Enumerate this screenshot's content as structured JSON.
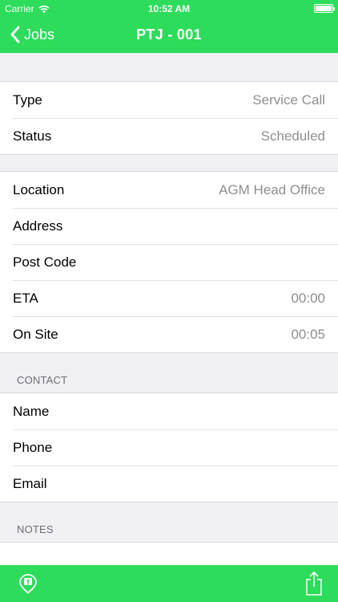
{
  "status_bar": {
    "carrier": "Carrier",
    "time": "10:52 AM",
    "wifi_icon": "wifi-icon",
    "battery_icon": "battery-icon"
  },
  "nav": {
    "back_label": "Jobs",
    "title": "PTJ - 001"
  },
  "job": {
    "type_label": "Type",
    "type_value": "Service Call",
    "status_label": "Status",
    "status_value": "Scheduled"
  },
  "site": {
    "location_label": "Location",
    "location_value": "AGM Head Office",
    "address_label": "Address",
    "address_value": "",
    "postcode_label": "Post Code",
    "postcode_value": "",
    "eta_label": "ETA",
    "eta_value": "00:00",
    "onsite_label": "On Site",
    "onsite_value": "00:05"
  },
  "contact": {
    "header": "CONTACT",
    "name_label": "Name",
    "name_value": "",
    "phone_label": "Phone",
    "phone_value": "",
    "email_label": "Email",
    "email_value": ""
  },
  "notes": {
    "header": "NOTES",
    "value": ""
  },
  "toolbar": {
    "left_icon": "location-pin-icon",
    "right_icon": "share-icon"
  },
  "colors": {
    "accent": "#2cdc5a",
    "background": "#efeff4",
    "secondary_text": "#8e8e93"
  }
}
